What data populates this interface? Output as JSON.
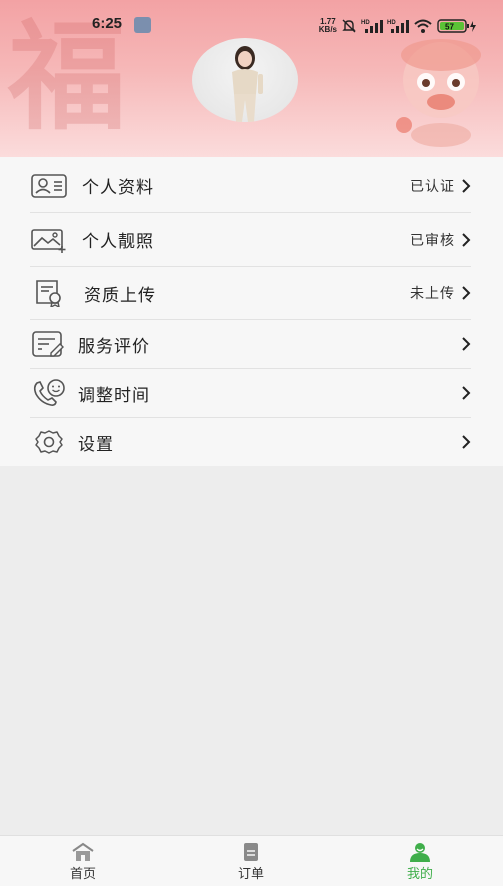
{
  "status_bar": {
    "time": "6:25",
    "net_speed_value": "1.77",
    "net_speed_unit": "KB/s",
    "battery": "57"
  },
  "profile": {
    "avatar_icon": "profile-photo"
  },
  "menu": {
    "items": [
      {
        "label": "个人资料",
        "status": "已认证",
        "icon": "id-card-icon"
      },
      {
        "label": "个人靓照",
        "status": "已审核",
        "icon": "photo-add-icon"
      },
      {
        "label": "资质上传",
        "status": "未上传",
        "icon": "certificate-icon"
      },
      {
        "label": "服务评价",
        "status": "",
        "icon": "review-edit-icon"
      },
      {
        "label": "调整时间",
        "status": "",
        "icon": "phone-smile-icon"
      },
      {
        "label": "设置",
        "status": "",
        "icon": "gear-icon"
      }
    ]
  },
  "tabbar": {
    "tabs": [
      {
        "label": "首页",
        "icon": "home-icon",
        "active": false
      },
      {
        "label": "订单",
        "icon": "order-document-icon",
        "active": false
      },
      {
        "label": "我的",
        "icon": "user-icon",
        "active": true
      }
    ]
  },
  "colors": {
    "header_gradient_top": "#f3a2a4",
    "active_tab": "#3fae4a",
    "menu_background": "#f7f7f7",
    "page_background": "#ededed"
  }
}
